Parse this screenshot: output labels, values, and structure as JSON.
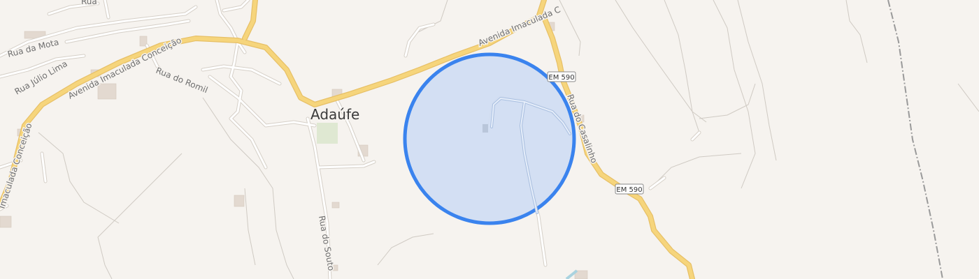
{
  "map": {
    "place_name": "Adaúfe",
    "streets": {
      "rua_da_mota": "Rua da Mota",
      "rua_julio_lima": "Rua Júlio Lima",
      "rua_top": "Rua",
      "avenida_w": "Avenida Imaculada Conceição",
      "avenida_ne": "Avenida Imaculada C",
      "avenida_vertical": "Imaculada Conceição",
      "rua_do_romil": "Rua do Romil",
      "rua_do_souto": "Rua do Souto",
      "rua_do_casalinho": "Rua do Casalinho"
    },
    "shields": {
      "em590_top": "EM 590",
      "em590_bottom": "EM 590"
    },
    "colors": {
      "background": "#f6f3ef",
      "major_road": "#f6d57c",
      "major_road_casing": "#e7c067",
      "minor_road": "#ffffff",
      "minor_road_casing": "#d6d0c8",
      "railway": "#9a9a9a",
      "circle_fill": "#cfddf3",
      "circle_stroke": "#3a83ee",
      "green_area": "#dfe8d2",
      "building": "#e3d9d0"
    }
  }
}
